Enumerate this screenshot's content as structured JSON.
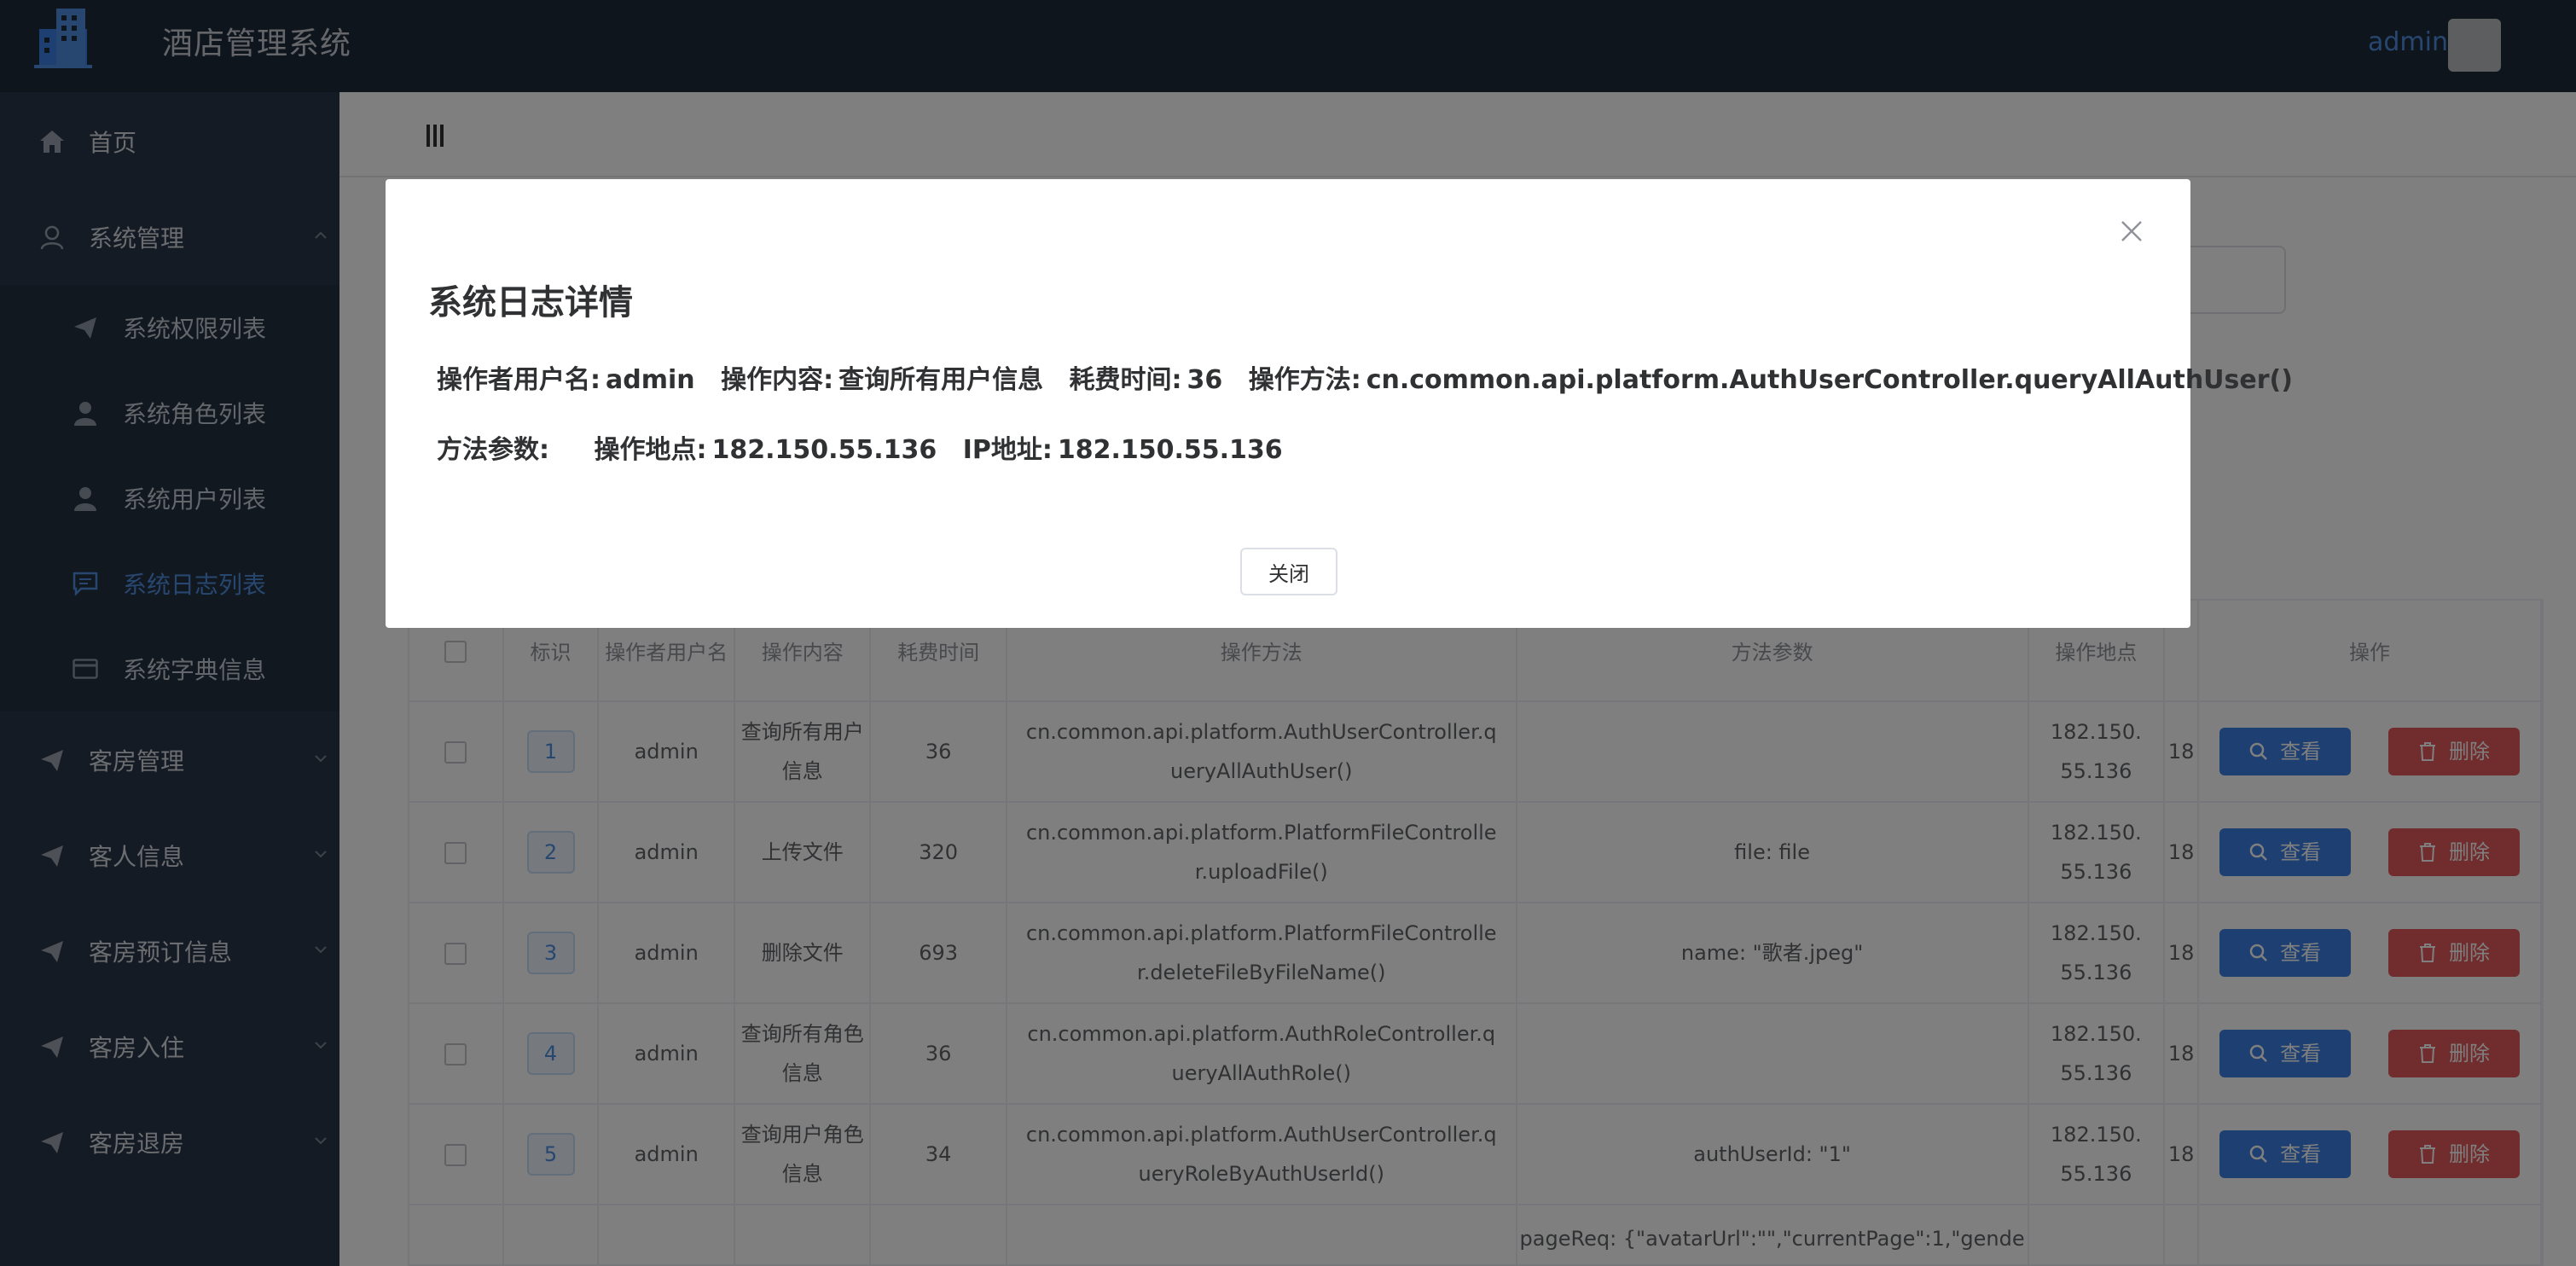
{
  "header": {
    "app_title": "酒店管理系统",
    "user_name": "admin"
  },
  "sidebar": {
    "items": [
      {
        "label": "首页",
        "icon": "home-icon"
      },
      {
        "label": "系统管理",
        "icon": "user-icon",
        "expanded": true
      },
      {
        "label": "系统权限列表",
        "icon": "paper-plane-icon",
        "sub": true
      },
      {
        "label": "系统角色列表",
        "icon": "user-filled-icon",
        "sub": true
      },
      {
        "label": "系统用户列表",
        "icon": "user-filled-icon",
        "sub": true
      },
      {
        "label": "系统日志列表",
        "icon": "chat-icon",
        "sub": true,
        "active": true
      },
      {
        "label": "系统字典信息",
        "icon": "card-icon",
        "sub": true
      },
      {
        "label": "客房管理",
        "icon": "paper-plane-icon"
      },
      {
        "label": "客人信息",
        "icon": "paper-plane-icon"
      },
      {
        "label": "客房预订信息",
        "icon": "paper-plane-icon"
      },
      {
        "label": "客房入住",
        "icon": "paper-plane-icon"
      },
      {
        "label": "客房退房",
        "icon": "paper-plane-icon"
      }
    ]
  },
  "table": {
    "headers": [
      "",
      "标识",
      "操作者用户名",
      "操作内容",
      "耗费时间",
      "操作方法",
      "方法参数",
      "操作地点",
      "",
      "操作"
    ],
    "rows": [
      {
        "id": "1",
        "user": "admin",
        "content": "查询所有用户信息",
        "time": "36",
        "method": "cn.common.api.platform.AuthUserController.queryAllAuthUser()",
        "params": "",
        "location": "182.150.55.136",
        "ip": "18"
      },
      {
        "id": "2",
        "user": "admin",
        "content": "上传文件",
        "time": "320",
        "method": "cn.common.api.platform.PlatformFileController.uploadFile()",
        "params": "file: file",
        "location": "182.150.55.136",
        "ip": "18"
      },
      {
        "id": "3",
        "user": "admin",
        "content": "删除文件",
        "time": "693",
        "method": "cn.common.api.platform.PlatformFileController.deleteFileByFileName()",
        "params": "name: \"歌者.jpeg\"",
        "location": "182.150.55.136",
        "ip": "18"
      },
      {
        "id": "4",
        "user": "admin",
        "content": "查询所有角色信息",
        "time": "36",
        "method": "cn.common.api.platform.AuthRoleController.queryAllAuthRole()",
        "params": "",
        "location": "182.150.55.136",
        "ip": "18"
      },
      {
        "id": "5",
        "user": "admin",
        "content": "查询用户角色信息",
        "time": "34",
        "method": "cn.common.api.platform.AuthUserController.queryRoleByAuthUserId()",
        "params": "authUserId: \"1\"",
        "location": "182.150.55.136",
        "ip": "18"
      },
      {
        "id": "",
        "user": "",
        "content": "",
        "time": "",
        "method": "",
        "params": "pageReq: {\"avatarUrl\":\"\",\"currentPage\":1,\"gende",
        "location": "",
        "ip": ""
      }
    ],
    "view_label": "查看",
    "delete_label": "删除"
  },
  "modal": {
    "title": "系统日志详情",
    "username_label": "操作者用户名:",
    "username": "admin",
    "content_label": "操作内容:",
    "content": "查询所有用户信息",
    "time_label": "耗费时间:",
    "time": "36",
    "method_label": "操作方法:",
    "method": "cn.common.api.platform.AuthUserController.queryAllAuthUser()",
    "params_label": "方法参数:",
    "params": "",
    "location_label": "操作地点:",
    "location": "182.150.55.136",
    "ip_label": "IP地址:",
    "ip": "182.150.55.136",
    "close_label": "关闭"
  },
  "colors": {
    "header_bg": "#1f2a3a",
    "sidebar_bg": "#2a3748",
    "accent": "#4f8fe0",
    "view_button": "#3a7ee2",
    "delete_button": "#e25a5a"
  }
}
